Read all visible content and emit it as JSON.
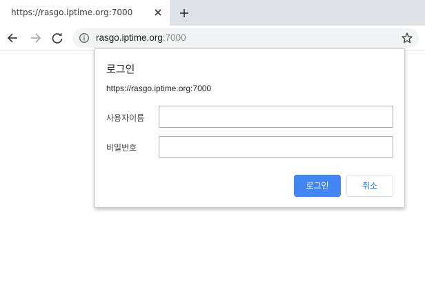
{
  "browser": {
    "tab": {
      "title": "https://rasgo.iptime.org:7000",
      "close_icon": "close-icon"
    },
    "new_tab_icon": "plus-icon",
    "toolbar": {
      "back_icon": "arrow-left-icon",
      "forward_icon": "arrow-right-icon",
      "reload_icon": "reload-icon",
      "omnibox": {
        "info_icon": "info-icon",
        "url_host": "rasgo.iptime.org",
        "url_port": ":7000",
        "star_icon": "star-icon"
      }
    }
  },
  "dialog": {
    "title": "로그인",
    "origin": "https://rasgo.iptime.org:7000",
    "username_label": "사용자이름",
    "username_value": "",
    "password_label": "비밀번호",
    "password_value": "",
    "login_button": "로그인",
    "cancel_button": "취소"
  },
  "colors": {
    "tabstrip_bg": "#dee1e6",
    "omnibox_bg": "#f1f3f4",
    "primary_button": "#4285f4",
    "cancel_text": "#1a73e8"
  }
}
